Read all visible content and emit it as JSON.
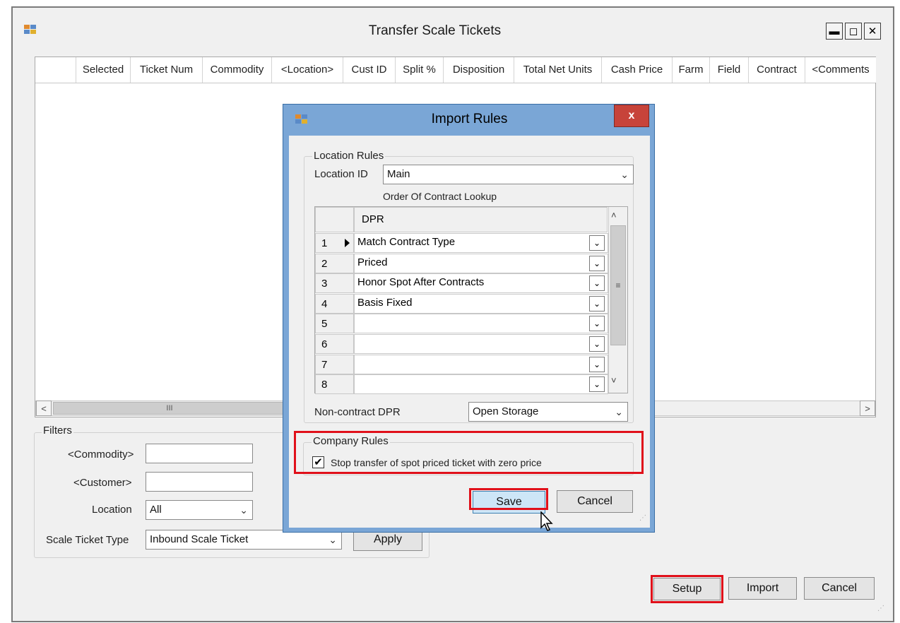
{
  "window": {
    "title": "Transfer Scale Tickets",
    "minimize": "▬",
    "maximize": "◻",
    "close": "✕"
  },
  "grid": {
    "columns": [
      "Selected",
      "Ticket Num",
      "Commodity",
      "<Location>",
      "Cust ID",
      "Split %",
      "Disposition",
      "Total Net Units",
      "Cash Price",
      "Farm",
      "Field",
      "Contract",
      "<Comments"
    ],
    "scroll_left": "<",
    "scroll_right": ">",
    "scroll_grip": "III"
  },
  "filters": {
    "group_label": "Filters",
    "commodity_label": "<Commodity>",
    "commodity_value": "",
    "customer_label": "<Customer>",
    "customer_value": "",
    "location_label": "Location",
    "location_value": "All",
    "ticket_type_label": "Scale Ticket Type",
    "ticket_type_value": "Inbound Scale Ticket",
    "apply": "Apply"
  },
  "bottom_buttons": {
    "setup": "Setup",
    "import": "Import",
    "cancel": "Cancel"
  },
  "dialog": {
    "title": "Import Rules",
    "close": "x",
    "location_rules_label": "Location Rules",
    "location_id_label": "Location ID",
    "location_id_value": "Main",
    "order_label": "Order Of Contract Lookup",
    "dpr_header": "DPR",
    "rows": [
      {
        "num": "1",
        "value": "Match Contract Type"
      },
      {
        "num": "2",
        "value": "Priced"
      },
      {
        "num": "3",
        "value": "Honor Spot After Contracts"
      },
      {
        "num": "4",
        "value": "Basis Fixed"
      },
      {
        "num": "5",
        "value": ""
      },
      {
        "num": "6",
        "value": ""
      },
      {
        "num": "7",
        "value": ""
      },
      {
        "num": "8",
        "value": ""
      }
    ],
    "non_contract_label": "Non-contract DPR",
    "non_contract_value": "Open Storage",
    "company_rules_label": "Company Rules",
    "stop_transfer_label": "Stop transfer of spot priced ticket with zero price",
    "stop_transfer_checked": true,
    "save": "Save",
    "cancel": "Cancel"
  },
  "colors": {
    "highlight": "#e0101a",
    "dialog_frame": "#7aa6d6",
    "save_focus": "#cde6f7"
  }
}
